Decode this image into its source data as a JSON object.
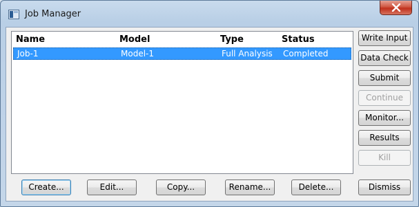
{
  "window": {
    "title": "Job Manager"
  },
  "table": {
    "columns": [
      "Name",
      "Model",
      "Type",
      "Status"
    ],
    "rows": [
      {
        "name": "Job-1",
        "model": "Model-1",
        "type": "Full Analysis",
        "status": "Completed",
        "selected": true
      }
    ]
  },
  "side_buttons": {
    "write_input": "Write Input",
    "data_check": "Data Check",
    "submit": "Submit",
    "continue": "Continue",
    "monitor": "Monitor...",
    "results": "Results",
    "kill": "Kill"
  },
  "bottom_buttons": {
    "create": "Create...",
    "edit": "Edit...",
    "copy": "Copy...",
    "rename": "Rename...",
    "delete": "Delete...",
    "dismiss": "Dismiss"
  },
  "colors": {
    "selection": "#3399ff",
    "close_button": "#c0301c"
  }
}
